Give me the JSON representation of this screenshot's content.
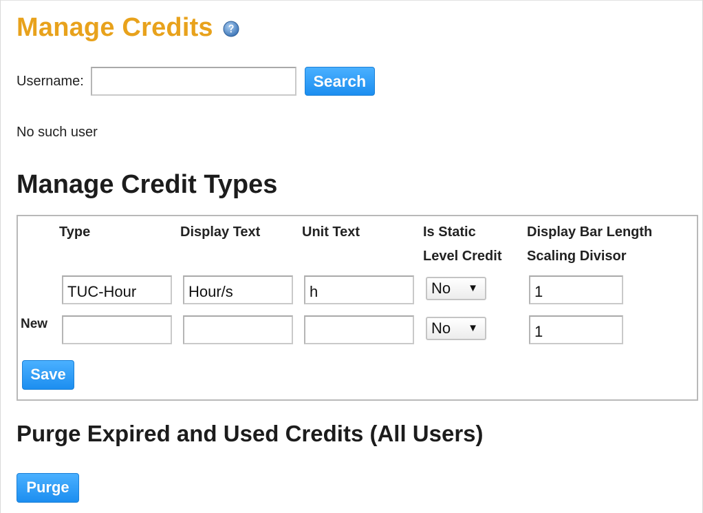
{
  "header": {
    "title": "Manage Credits",
    "help_icon": "help-icon"
  },
  "search": {
    "label": "Username:",
    "value": "",
    "placeholder": "",
    "button_label": "Search"
  },
  "status": {
    "message": "No such user"
  },
  "credit_types": {
    "title": "Manage Credit Types",
    "columns": [
      "Type",
      "Display Text",
      "Unit Text",
      "Is Static\nLevel Credit",
      "Display Bar Length\nScaling Divisor"
    ],
    "rows": [
      {
        "label": "",
        "type": "TUC-Hour",
        "display_text": "Hour/s",
        "unit_text": "h",
        "is_static": "No",
        "divisor": "1"
      },
      {
        "label": "New",
        "type": "",
        "display_text": "",
        "unit_text": "",
        "is_static": "No",
        "divisor": "1"
      }
    ],
    "save_label": "Save"
  },
  "purge": {
    "title": "Purge Expired and Used Credits (All Users)",
    "button_label": "Purge"
  },
  "colors": {
    "title_orange": "#e8a21c",
    "button_blue": "#1c8ef0",
    "border_gray": "#b8b8b8"
  }
}
